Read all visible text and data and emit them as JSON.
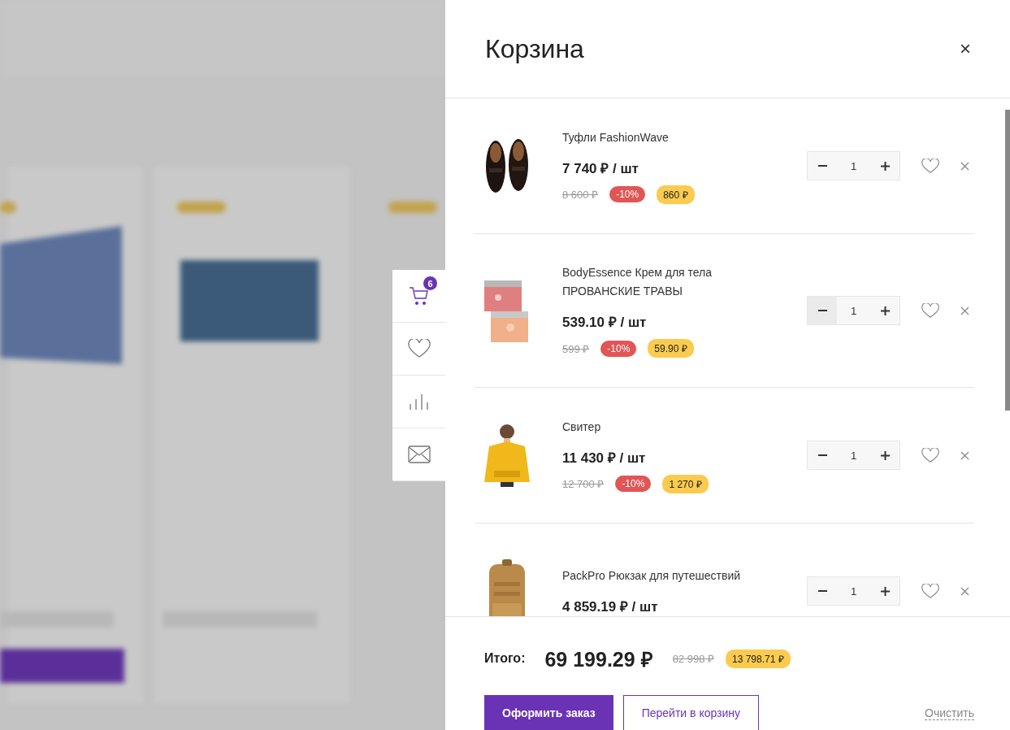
{
  "side_toolbar": [
    {
      "kind": "cart",
      "badge": "6",
      "selected": true
    },
    {
      "kind": "favorites",
      "selected": false
    },
    {
      "kind": "compare",
      "selected": false
    },
    {
      "kind": "mail",
      "selected": false
    }
  ],
  "cart": {
    "title": "Корзина",
    "close": "×",
    "items": [
      {
        "kind": "shoes",
        "name": "Туфли FashionWave",
        "price": "7 740 ₽ / шт",
        "old_price": "8 600 ₽",
        "discount": "-10%",
        "saving": "860 ₽",
        "quantity": "1"
      },
      {
        "kind": "jars",
        "name": "BodyEssence Крем для тела ПРОВАНСКИЕ ТРАВЫ",
        "price": "539.10 ₽ / шт",
        "old_price": "599 ₽",
        "discount": "-10%",
        "saving": "59.90 ₽",
        "quantity": "1"
      },
      {
        "kind": "sweater",
        "name": "Свитер",
        "price": "11 430 ₽ / шт",
        "old_price": "12 700 ₽",
        "discount": "-10%",
        "saving": "1 270 ₽",
        "quantity": "1"
      },
      {
        "kind": "backpack",
        "name": "PackPro Рюкзак для путешествий",
        "price": "4 859.19 ₽ / шт",
        "quantity": "1"
      }
    ],
    "total": {
      "label": "Итого:",
      "amount": "69 199.29 ₽",
      "old_amount": "82 998 ₽",
      "saving": "13 798.71 ₽"
    },
    "checkout_button": "Оформить заказ",
    "cart_button": "Перейти в корзину",
    "clear_link": "Очистить"
  }
}
